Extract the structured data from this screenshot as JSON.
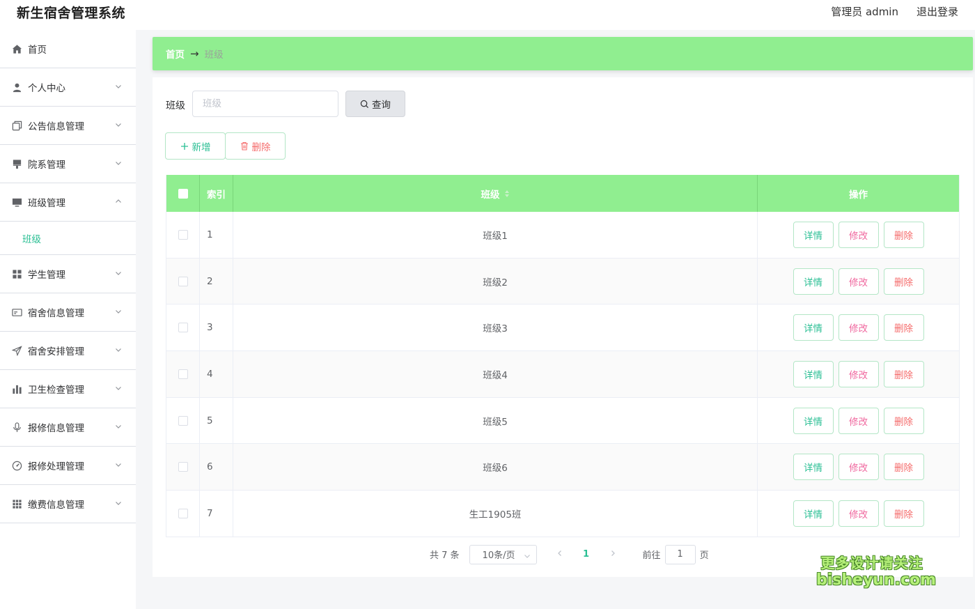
{
  "header": {
    "app_title": "新生宿舍管理系统",
    "admin_label": "管理员 admin",
    "logout_label": "退出登录"
  },
  "sidebar": {
    "items": [
      {
        "label": "首页",
        "icon": "home-icon"
      },
      {
        "label": "个人中心",
        "icon": "user-icon"
      },
      {
        "label": "公告信息管理",
        "icon": "copy-icon"
      },
      {
        "label": "院系管理",
        "icon": "brush-icon"
      },
      {
        "label": "班级管理",
        "icon": "monitor-icon",
        "expanded": true
      },
      {
        "label": "学生管理",
        "icon": "grid-icon"
      },
      {
        "label": "宿舍信息管理",
        "icon": "postcard-icon"
      },
      {
        "label": "宿舍安排管理",
        "icon": "send-icon"
      },
      {
        "label": "卫生检查管理",
        "icon": "bar-chart-icon"
      },
      {
        "label": "报修信息管理",
        "icon": "microphone-icon"
      },
      {
        "label": "报修处理管理",
        "icon": "odometer-icon"
      },
      {
        "label": "缴费信息管理",
        "icon": "menu-grid-icon"
      }
    ],
    "submenu": {
      "label": "班级"
    }
  },
  "breadcrumb": {
    "home": "首页",
    "separator": "→",
    "current": "班级"
  },
  "search": {
    "label": "班级",
    "placeholder": "班级",
    "value": "",
    "query_label": "查询"
  },
  "toolbar": {
    "add_label": "新增",
    "delete_label": "删除"
  },
  "table": {
    "headers": {
      "index": "索引",
      "name": "班级",
      "actions": "操作"
    },
    "rows": [
      {
        "index": "1",
        "name": "班级1"
      },
      {
        "index": "2",
        "name": "班级2"
      },
      {
        "index": "3",
        "name": "班级3"
      },
      {
        "index": "4",
        "name": "班级4"
      },
      {
        "index": "5",
        "name": "班级5"
      },
      {
        "index": "6",
        "name": "班级6"
      },
      {
        "index": "7",
        "name": "生工1905班"
      }
    ],
    "row_actions": {
      "detail": "详情",
      "edit": "修改",
      "delete": "删除"
    }
  },
  "pagination": {
    "total_text": "共 7 条",
    "page_size": "10条/页",
    "current_page": "1",
    "goto_label": "前往",
    "goto_value": "1",
    "page_suffix": "页"
  },
  "watermark": {
    "line1": "更多设计请关注",
    "line2": "bisheyun.com"
  },
  "colors": {
    "accent_green": "#90ee90",
    "primary": "#2bbf94",
    "danger": "#f56c6c",
    "edit_pink": "#f06aa0"
  }
}
